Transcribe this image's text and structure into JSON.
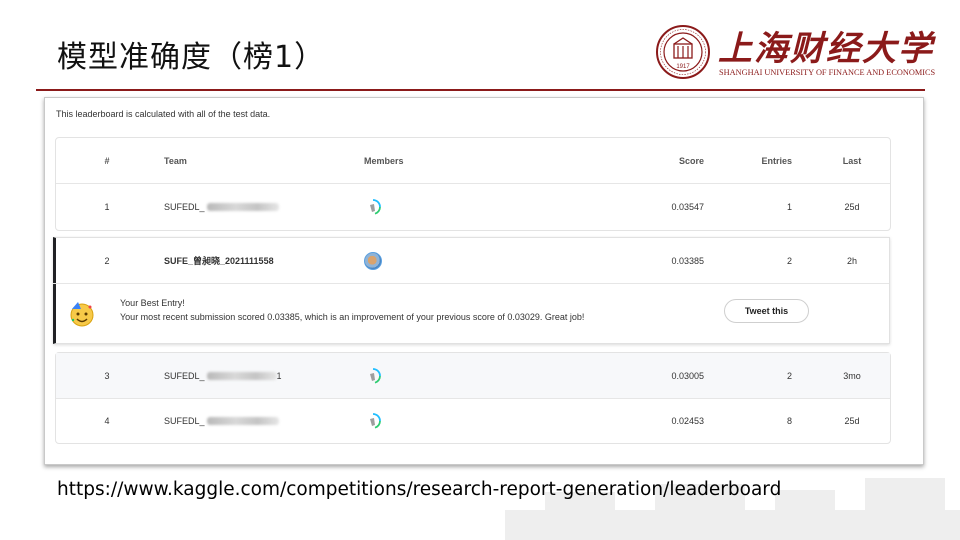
{
  "slide": {
    "title": "模型准确度（榜1）",
    "url": "https://www.kaggle.com/competitions/research-report-generation/leaderboard"
  },
  "logo": {
    "name_cn": "上海财经大学",
    "name_en": "SHANGHAI UNIVERSITY OF FINANCE AND ECONOMICS",
    "seal_year": "1917",
    "brand_color": "#8b1a1a"
  },
  "leaderboard": {
    "note": "This leaderboard is calculated with all of the test data.",
    "columns": {
      "rank": "#",
      "team": "Team",
      "members": "Members",
      "score": "Score",
      "entries": "Entries",
      "last": "Last"
    },
    "rows": [
      {
        "rank": "1",
        "team": "SUFEDL_",
        "score": "0.03547",
        "entries": "1",
        "last": "25d"
      },
      {
        "rank": "2",
        "team": "SUFE_曾昶晓_2021111558",
        "score": "0.03385",
        "entries": "2",
        "last": "2h"
      },
      {
        "rank": "3",
        "team": "SUFEDL_",
        "team_suffix": "1",
        "score": "0.03005",
        "entries": "2",
        "last": "3mo"
      },
      {
        "rank": "4",
        "team": "SUFEDL_",
        "score": "0.02453",
        "entries": "8",
        "last": "25d"
      }
    ],
    "best_entry": {
      "title": "Your Best Entry!",
      "message": "Your most recent submission scored 0.03385, which is an improvement of your previous score of 0.03029. Great job!",
      "tweet_label": "Tweet this"
    }
  }
}
